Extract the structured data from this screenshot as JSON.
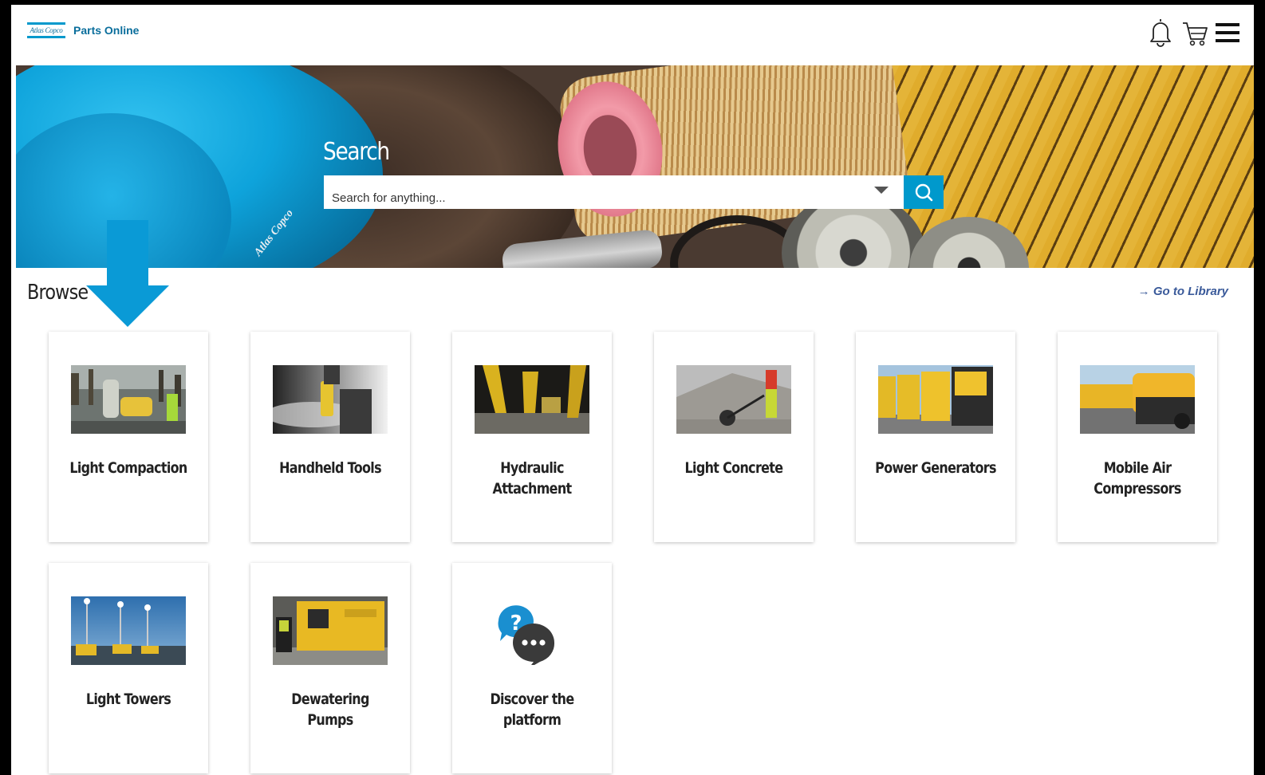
{
  "header": {
    "logo_text": "Atlas Copco",
    "app_title": "Parts Online"
  },
  "hero": {
    "title": "Search",
    "search_placeholder": "Search for anything...",
    "stamp_text": "Atlas Copco"
  },
  "browse": {
    "title": "Browse",
    "library_link": "→ Go to Library",
    "cards": [
      {
        "label": "Light Compaction"
      },
      {
        "label": "Handheld Tools"
      },
      {
        "label": "Hydraulic Attachment"
      },
      {
        "label": "Light Concrete"
      },
      {
        "label": "Power Generators"
      },
      {
        "label": "Mobile Air Compressors"
      },
      {
        "label": "Light Towers"
      },
      {
        "label": "Dewatering Pumps"
      },
      {
        "label": "Discover the platform"
      }
    ]
  },
  "colors": {
    "brand_blue": "#0099cc",
    "link_blue": "#3a5a9a",
    "text_dark": "#222222"
  }
}
